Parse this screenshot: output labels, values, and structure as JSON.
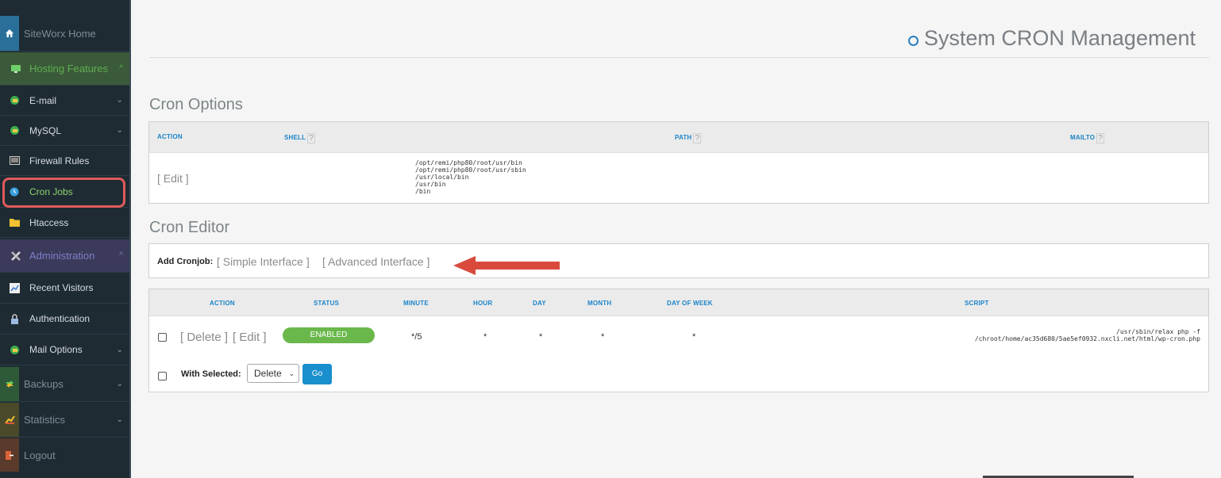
{
  "sidebar": {
    "home": "SiteWorx Home",
    "hosting_features": "Hosting Features",
    "email": "E-mail",
    "mysql": "MySQL",
    "firewall": "Firewall Rules",
    "cron": "Cron Jobs",
    "htaccess": "Htaccess",
    "administration": "Administration",
    "recent_visitors": "Recent Visitors",
    "authentication": "Authentication",
    "mail_options": "Mail Options",
    "backups": "Backups",
    "statistics": "Statistics",
    "logout": "Logout"
  },
  "page": {
    "title": "System CRON Management"
  },
  "cron_options": {
    "title": "Cron Options",
    "headers": {
      "action": "ACTION",
      "shell": "SHELL",
      "path": "PATH",
      "mailto": "MAILTO",
      "help": "?"
    },
    "edit": "[ Edit ]",
    "paths": [
      "/opt/remi/php80/root/usr/bin",
      "/opt/remi/php80/root/usr/sbin",
      "/usr/local/bin",
      "/usr/bin",
      "/bin"
    ]
  },
  "cron_editor": {
    "title": "Cron Editor",
    "add_label": "Add Cronjob:",
    "simple": "[ Simple Interface ]",
    "advanced": "[ Advanced Interface ]"
  },
  "jobs_table": {
    "headers": {
      "action": "ACTION",
      "status": "STATUS",
      "minute": "MINUTE",
      "hour": "HOUR",
      "day": "DAY",
      "month": "MONTH",
      "dow": "DAY OF WEEK",
      "script": "SCRIPT"
    },
    "row": {
      "delete": "[ Delete ]",
      "edit": "[ Edit ]",
      "status": "ENABLED",
      "minute": "*/5",
      "hour": "*",
      "day": "*",
      "month": "*",
      "dow": "*",
      "script_line1": "/usr/sbin/relax php -f",
      "script_line2": "/chroot/home/ac35d680/5ae5ef0932.nxcli.net/html/wp-cron.php"
    },
    "with_selected": "With Selected:",
    "select_value": "Delete",
    "go": "Go"
  },
  "colors": {
    "accent_blue": "#1a84c8",
    "enabled_green": "#6ab84b",
    "highlight_red": "#e05a5a",
    "arrow_red": "#d94a3d"
  }
}
